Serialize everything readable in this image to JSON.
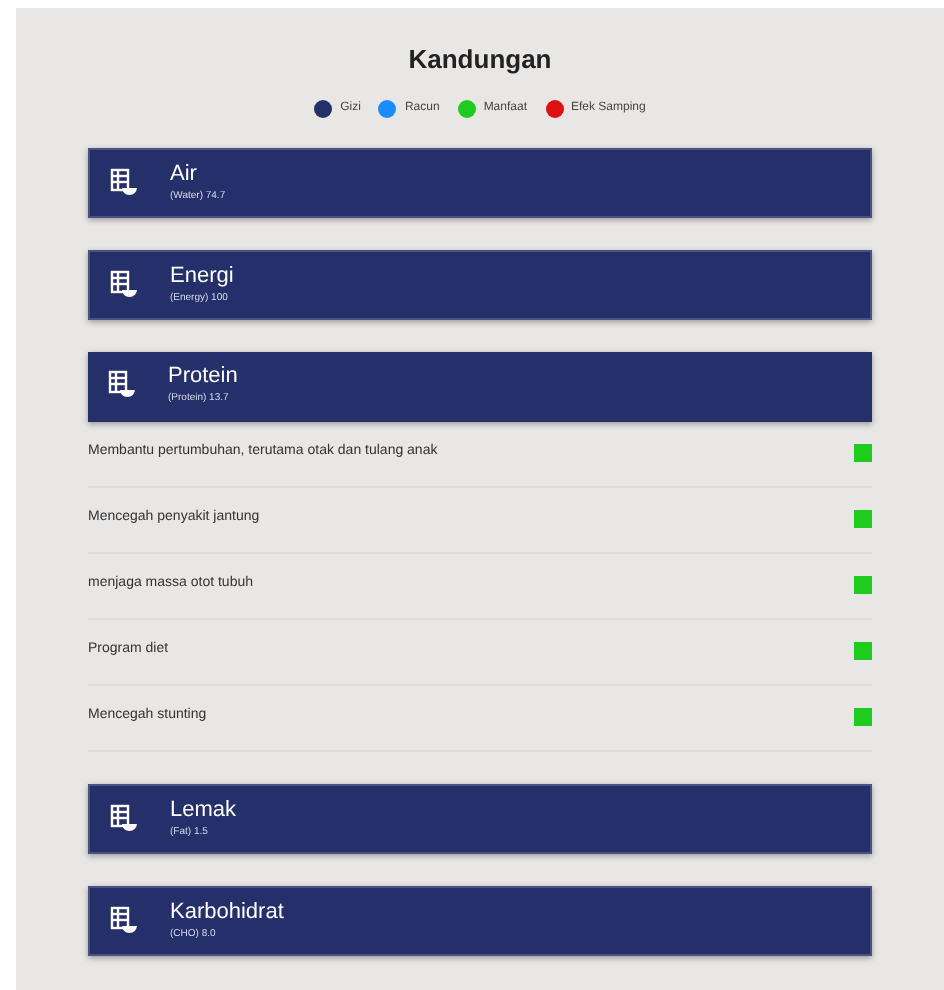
{
  "title": "Kandungan",
  "legend": [
    {
      "label": "Gizi",
      "color": "#25306a"
    },
    {
      "label": "Racun",
      "color": "#1a8cff"
    },
    {
      "label": "Manfaat",
      "color": "#1ecb1e"
    },
    {
      "label": "Efek Samping",
      "color": "#dd1111"
    }
  ],
  "sections": [
    {
      "name": "Air",
      "detail": "(Water) 74.7",
      "expanded": false
    },
    {
      "name": "Energi",
      "detail": "(Energy) 100",
      "expanded": false
    },
    {
      "name": "Protein",
      "detail": "(Protein) 13.7",
      "expanded": true,
      "items": [
        {
          "text": "Membantu pertumbuhan, terutama otak dan tulang anak",
          "color": "#1ecb1e"
        },
        {
          "text": "Mencegah penyakit jantung",
          "color": "#1ecb1e"
        },
        {
          "text": "menjaga massa otot tubuh",
          "color": "#1ecb1e"
        },
        {
          "text": "Program diet",
          "color": "#1ecb1e"
        },
        {
          "text": "Mencegah stunting",
          "color": "#1ecb1e"
        }
      ]
    },
    {
      "name": "Lemak",
      "detail": "(Fat) 1.5",
      "expanded": false
    },
    {
      "name": "Karbohidrat",
      "detail": "(CHO) 8.0",
      "expanded": false
    }
  ]
}
